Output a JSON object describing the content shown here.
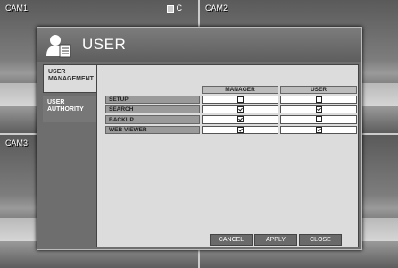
{
  "cameras": [
    "CAM1",
    "CAM2",
    "CAM3",
    ""
  ],
  "cam1_indicator": "C",
  "dialog": {
    "title": "USER",
    "sidebar": [
      "USER MANAGEMENT",
      "USER AUTHORITY"
    ]
  },
  "table": {
    "columns": [
      "MANAGER",
      "USER"
    ],
    "rows": [
      {
        "label": "SETUP",
        "manager": false,
        "user": false
      },
      {
        "label": "SEARCH",
        "manager": true,
        "user": true
      },
      {
        "label": "BACKUP",
        "manager": true,
        "user": false
      },
      {
        "label": "WEB VIEWER",
        "manager": true,
        "user": true
      }
    ]
  },
  "buttons": {
    "cancel": "CANCEL",
    "apply": "APPLY",
    "close": "CLOSE"
  }
}
